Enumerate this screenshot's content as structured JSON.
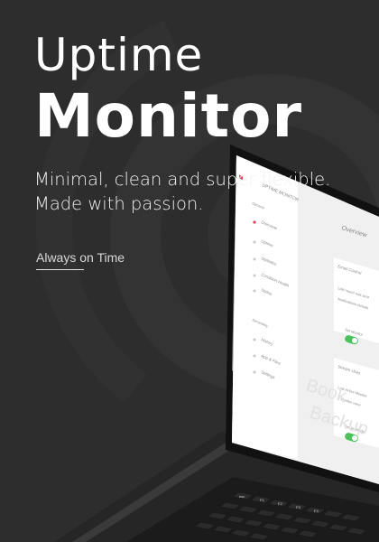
{
  "hero": {
    "title_line1": "Uptime",
    "title_line2": "Monitor",
    "tagline_line1": "Minimal, clean and super flexible.",
    "tagline_line2": "Made with passion.",
    "cta_label": "Always on Time"
  },
  "app": {
    "brand": "UPTIME MONITOR",
    "section_general": "General",
    "nav_items": [
      {
        "label": "Overview"
      },
      {
        "label": "Uptime"
      },
      {
        "label": "Statistics"
      },
      {
        "label": "Condition Health"
      },
      {
        "label": "Status"
      }
    ],
    "section_secondary": "Secondary",
    "nav_secondary": [
      {
        "label": "History"
      },
      {
        "label": "App & Files"
      },
      {
        "label": "Settings"
      }
    ],
    "page_title": "Overview",
    "card1": {
      "title": "Email Control",
      "line1": "Last report was sent",
      "line2": "Notifications include",
      "toggle_label": "Set Monitor"
    },
    "card2": {
      "title": "Stream Uses",
      "line1": "Last Active Monitor",
      "line2": "2 Monitor were",
      "toggle_label": "Set by Mode"
    },
    "background_words": [
      "Book",
      "Backup"
    ]
  },
  "colors": {
    "background": "#2d2d2d",
    "accent_red": "#e0455a",
    "toggle_green": "#4cc35a"
  }
}
